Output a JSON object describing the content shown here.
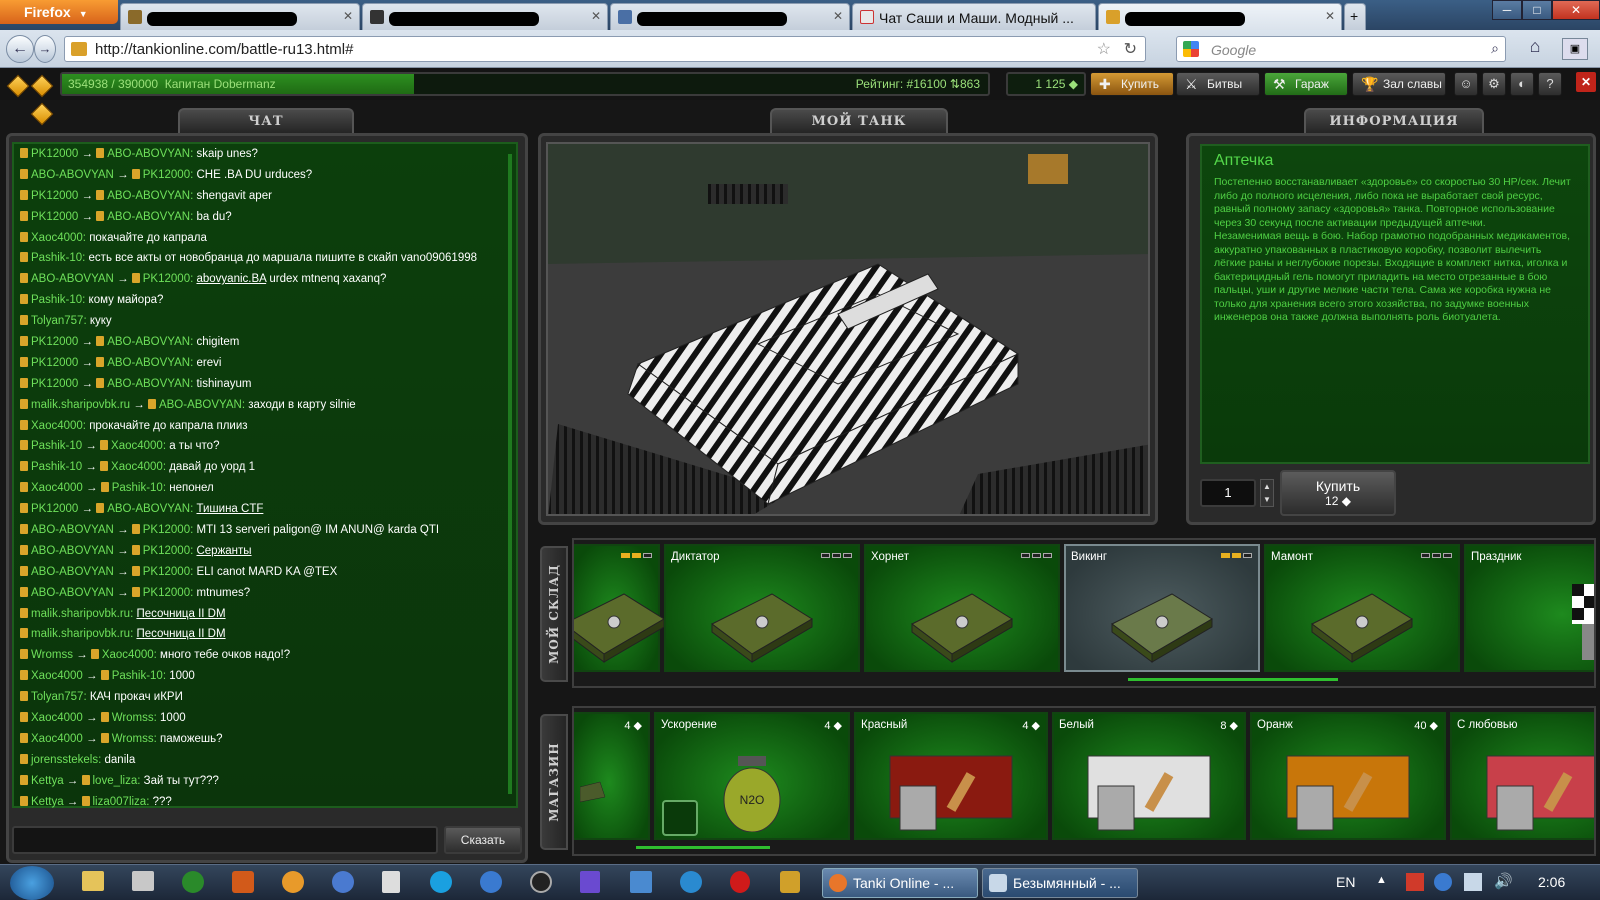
{
  "browser": {
    "app_button": "Firefox",
    "tabs": [
      {
        "label": "",
        "redacted": true
      },
      {
        "label": "",
        "redacted": true
      },
      {
        "label": "",
        "redacted": true
      },
      {
        "label": "Чат Саши и Маши. Модный ...",
        "redacted": false
      },
      {
        "label": "",
        "redacted": true
      }
    ],
    "url": "http://tankionline.com/battle-ru13.html#",
    "search_placeholder": "Google"
  },
  "game": {
    "xp": "354938 / 390000",
    "xp_fraction": 0.38,
    "player": "Капитан Dobermanz",
    "rating": "Рейтинг: #16100",
    "rating_delta": "863",
    "crystals": "1 125",
    "buttons": {
      "buy": "Купить",
      "battles": "Битвы",
      "garage": "Гараж",
      "hall": "Зал славы"
    },
    "panel_tabs": {
      "chat": "ЧАТ",
      "my_tank": "МОЙ ТАНК",
      "info": "ИНФОРМАЦИЯ"
    }
  },
  "chat": {
    "say_button": "Сказать",
    "messages": [
      {
        "from": "PK12000",
        "to": "ABO-ABOVYAN",
        "text": "skaip unes?"
      },
      {
        "from": "ABO-ABOVYAN",
        "to": "PK12000",
        "text": "CHE .BA DU urduces?"
      },
      {
        "from": "PK12000",
        "to": "ABO-ABOVYAN",
        "text": "shengavit aper"
      },
      {
        "from": "PK12000",
        "to": "ABO-ABOVYAN",
        "text": "ba du?"
      },
      {
        "from": "Xaoc4000",
        "to": "",
        "text": "покачайте до капрала"
      },
      {
        "from": "Pashik-10",
        "to": "",
        "text": "есть все акты от новобранца до маршала пишите в скайп vano09061998"
      },
      {
        "from": "ABO-ABOVYAN",
        "to": "PK12000",
        "text": "abovyanic.BA",
        "text2": " urdex mtnenq xaxanq?"
      },
      {
        "from": "Pashik-10",
        "to": "",
        "text": "кому майора?"
      },
      {
        "from": "Tolyan757",
        "to": "",
        "text": "куку"
      },
      {
        "from": "PK12000",
        "to": "ABO-ABOVYAN",
        "text": "chigitem"
      },
      {
        "from": "PK12000",
        "to": "ABO-ABOVYAN",
        "text": "erevi"
      },
      {
        "from": "PK12000",
        "to": "ABO-ABOVYAN",
        "text": "tishinayum"
      },
      {
        "from": "malik.sharipovbk.ru",
        "to": "ABO-ABOVYAN",
        "text": "заходи    в    карту  silnie"
      },
      {
        "from": "Xaoc4000",
        "to": "",
        "text": "прокачайте до капрала плииз"
      },
      {
        "from": "Pashik-10",
        "to": "Xaoc4000",
        "text": "а ты что?"
      },
      {
        "from": "Pashik-10",
        "to": "Xaoc4000",
        "text": "давай до уорд 1"
      },
      {
        "from": "Xaoc4000",
        "to": "Pashik-10",
        "text": "непонел"
      },
      {
        "from": "PK12000",
        "to": "ABO-ABOVYAN",
        "text": "Тишина CTF"
      },
      {
        "from": "ABO-ABOVYAN",
        "to": "PK12000",
        "text": "MTI 13 serveri paligon@ IM ANUN@ karda QTI"
      },
      {
        "from": "ABO-ABOVYAN",
        "to": "PK12000",
        "text": "Сержанты"
      },
      {
        "from": "ABO-ABOVYAN",
        "to": "PK12000",
        "text": "ELI canot MARD KA @TEX"
      },
      {
        "from": "ABO-ABOVYAN",
        "to": "PK12000",
        "text": "mtnumes?"
      },
      {
        "from": "malik.sharipovbk.ru",
        "to": "",
        "text": "Песочница II DM"
      },
      {
        "from": "malik.sharipovbk.ru",
        "to": "",
        "text": "Песочница II DM"
      },
      {
        "from": "Wromss",
        "to": "Xaoc4000",
        "text": "много тебе очков надо!?"
      },
      {
        "from": "Xaoc4000",
        "to": "Pashik-10",
        "text": "1000"
      },
      {
        "from": "Tolyan757",
        "to": "",
        "text": "КАЧ прокач иКРИ"
      },
      {
        "from": "Xaoc4000",
        "to": "Wromss",
        "text": "1000"
      },
      {
        "from": "Xaoc4000",
        "to": "Wromss",
        "text": "паможешь?"
      },
      {
        "from": "jorensstekels",
        "to": "",
        "text": "danila"
      },
      {
        "from": "Kettya",
        "to": "love_liza",
        "text": "Зай ты тут???"
      },
      {
        "from": "Kettya",
        "to": "liza007liza",
        "text": "???"
      }
    ]
  },
  "info": {
    "title": "Аптечка",
    "text": "Постепенно восстанавливает «здоровье» со скоростью 30 HP/сек. Лечит либо до полного исцеления, либо пока не выработает свой ресурс, равный полному запасу «здоровья» танка. Повторное использование через 30 секунд после активации предыдущей аптечки.",
    "text2": "Незаменимая вещь в бою. Набор грамотно подобранных медикаментов, аккуратно упакованных в пластиковую коробку, позволит вылечить лёгкие раны и неглубокие порезы. Входящие в комплект нитка, иголка и бактерицидный гель помогут приладить на место отрезанные в бою пальцы, уши и другие мелкие части тела. Сама же коробка нужна не только для хранения всего этого хозяйства, по задумке военных инженеров она также должна выполнять роль биотуалета.",
    "quantity": "1",
    "buy_label": "Купить",
    "buy_price": "12"
  },
  "warehouse": {
    "label": "МОЙ СКЛАД",
    "items": [
      {
        "name": "",
        "level": 2
      },
      {
        "name": "Диктатор",
        "level": 0
      },
      {
        "name": "Хорнет",
        "level": 0
      },
      {
        "name": "Викинг",
        "level": 2
      },
      {
        "name": "Мамонт",
        "level": 0
      },
      {
        "name": "Праздник",
        "level": 0
      }
    ]
  },
  "shop": {
    "label": "МАГАЗИН",
    "items": [
      {
        "name": "",
        "price": "4"
      },
      {
        "name": "Ускорение",
        "price": "4"
      },
      {
        "name": "Красный",
        "price": "4"
      },
      {
        "name": "Белый",
        "price": "8"
      },
      {
        "name": "Оранж",
        "price": "40"
      },
      {
        "name": "С любовью",
        "price": ""
      }
    ]
  },
  "taskbar": {
    "windows": [
      "Tanki Online - ...",
      "Безымянный - ..."
    ],
    "lang": "EN",
    "time": "2:06"
  }
}
